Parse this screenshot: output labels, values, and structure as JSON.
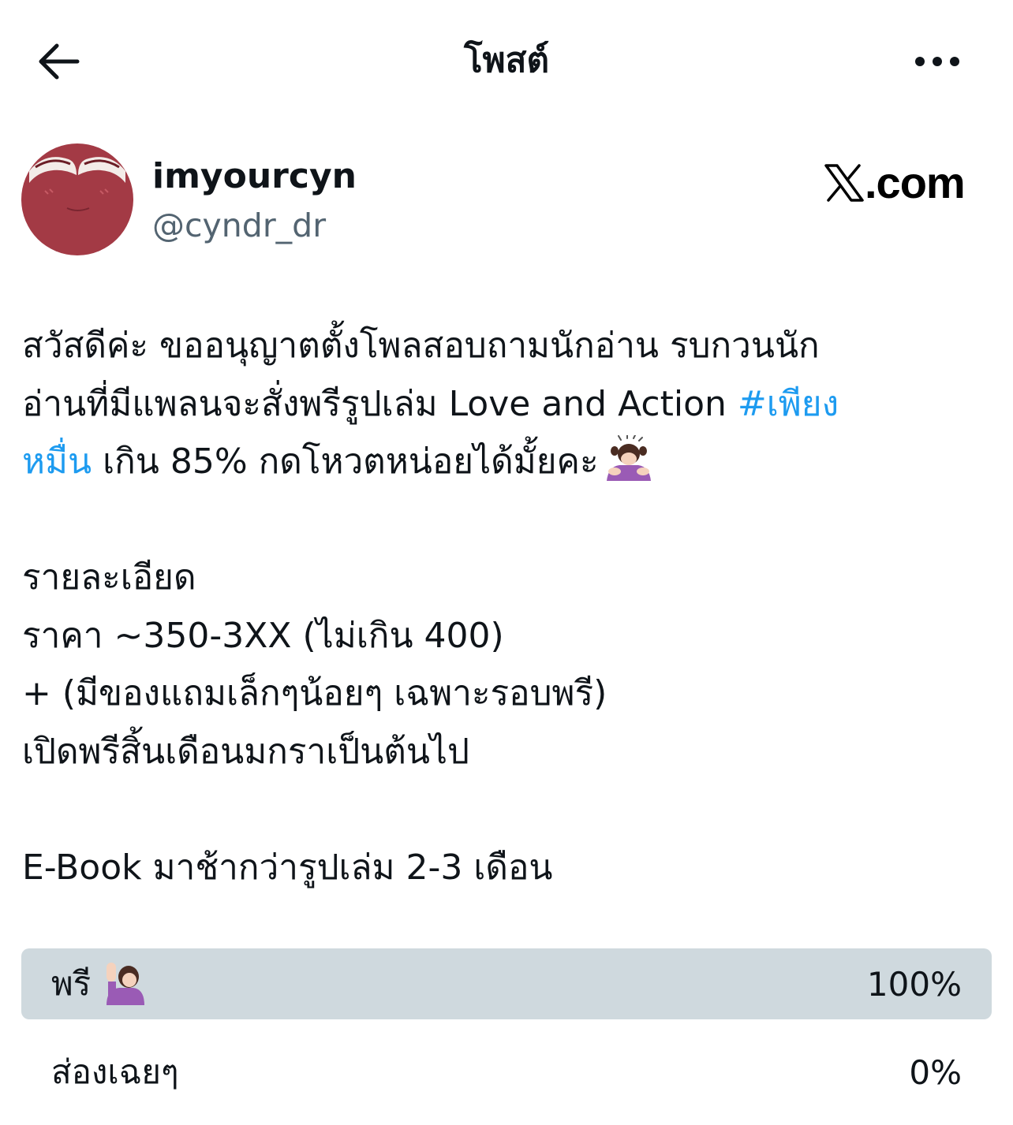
{
  "header": {
    "title": "โพสต์",
    "back_icon": "arrow-left-icon",
    "more_icon": "more-horizontal-icon"
  },
  "author": {
    "display_name": "imyourcyn",
    "handle": "@cyndr_dr",
    "avatar_color": "#a33a45"
  },
  "watermark": {
    "logo": "x-logo-icon",
    "text": ".com"
  },
  "tweet": {
    "line1": "สวัสดีค่ะ ขออนุญาตตั้งโพลสอบถามนักอ่าน รบกวนนัก",
    "line2_pre": "อ่านที่มีแพลนจะสั่งพรีรูปเล่ม Love and Action ",
    "hashtag_part1": "#เพียง",
    "hashtag_part2": "หมื่น",
    "line3_post": " เกิน 85% กดโหวตหน่อยได้มั้ยคะ",
    "details_heading": "รายละเอียด",
    "price": "ราคา ~350-3XX (ไม่เกิน 400)",
    "bonus": "+ (มีของแถมเล็กๆน้อยๆ เฉพาะรอบพรี)",
    "preorder_open": "เปิดพรีสิ้นเดือนมกราเป็นต้นไป",
    "ebook": "E-Book มาช้ากว่ารูปเล่ม 2-3 เดือน",
    "hashtag_color": "#1d9bf0"
  },
  "poll": {
    "options": [
      {
        "label": "พรี",
        "percent_text": "100%",
        "percent": 100,
        "emoji": "person-raising-hand-icon"
      },
      {
        "label": "ส่องเฉยๆ",
        "percent_text": "0%",
        "percent": 0
      }
    ],
    "fill_color": "#cfd9de"
  }
}
